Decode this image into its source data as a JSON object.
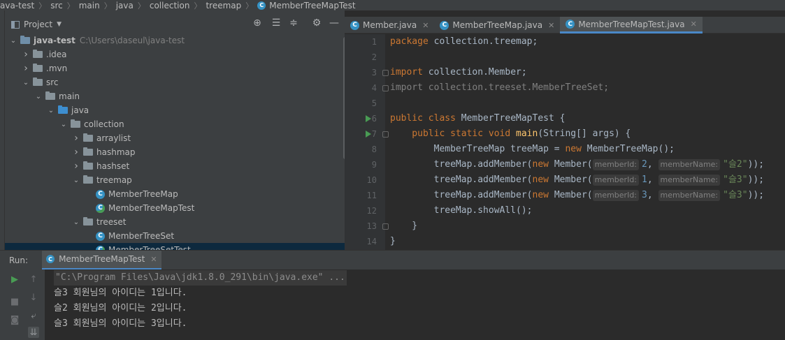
{
  "breadcrumb": [
    "ava-test",
    "src",
    "main",
    "java",
    "collection",
    "treemap",
    "MemberTreeMapTest"
  ],
  "project_panel": {
    "title": "Project",
    "tree": [
      {
        "label": "java-test",
        "extra": "C:\\Users\\daseul\\java-test",
        "icon": "module-folder-icon",
        "expanded": true,
        "depth": 0
      },
      {
        "label": ".idea",
        "icon": "folder-icon",
        "expanded": false,
        "depth": 1
      },
      {
        "label": ".mvn",
        "icon": "folder-icon",
        "expanded": false,
        "depth": 1
      },
      {
        "label": "src",
        "icon": "folder-icon",
        "expanded": true,
        "depth": 1
      },
      {
        "label": "main",
        "icon": "folder-icon",
        "expanded": true,
        "depth": 2
      },
      {
        "label": "java",
        "icon": "source-folder-icon",
        "expanded": true,
        "depth": 3
      },
      {
        "label": "collection",
        "icon": "package-icon",
        "expanded": true,
        "depth": 4
      },
      {
        "label": "arraylist",
        "icon": "package-icon",
        "expanded": false,
        "depth": 5
      },
      {
        "label": "hashmap",
        "icon": "package-icon",
        "expanded": false,
        "depth": 5
      },
      {
        "label": "hashset",
        "icon": "package-icon",
        "expanded": false,
        "depth": 5
      },
      {
        "label": "treemap",
        "icon": "package-icon",
        "expanded": true,
        "depth": 5
      },
      {
        "label": "MemberTreeMap",
        "icon": "class-icon",
        "depth": 6
      },
      {
        "label": "MemberTreeMapTest",
        "icon": "runnable-class-icon",
        "depth": 6
      },
      {
        "label": "treeset",
        "icon": "package-icon",
        "expanded": true,
        "depth": 5
      },
      {
        "label": "MemberTreeSet",
        "icon": "class-icon",
        "depth": 6
      },
      {
        "label": "MemberTreeSetTest",
        "icon": "runnable-class-icon",
        "depth": 6,
        "selected": true
      }
    ]
  },
  "editor": {
    "tabs": [
      {
        "label": "Member.java",
        "active": false
      },
      {
        "label": "MemberTreeMap.java",
        "active": false
      },
      {
        "label": "MemberTreeMapTest.java",
        "active": true
      }
    ],
    "code": {
      "l1_kw": "package ",
      "l1_rest": "collection.treemap;",
      "l3_kw": "import ",
      "l3_rest": "collection.Member;",
      "l4": "import collection.treeset.MemberTreeSet;",
      "l6_kw": "public class ",
      "l6_rest": "MemberTreeMapTest {",
      "l7_kw": "    public static void ",
      "l7_fn": "main",
      "l7_rest": "(String[] args) {",
      "l8_a": "        MemberTreeMap treeMap = ",
      "l8_kw": "new ",
      "l8_b": "MemberTreeMap();",
      "calls": [
        {
          "pre": "        treeMap.addMember(",
          "kw": "new ",
          "cls": "Member(",
          "hint1": "memberId:",
          "num": "2",
          "hint2": "memberName:",
          "str": "\"슬2\"",
          "end": "));"
        },
        {
          "pre": "        treeMap.addMember(",
          "kw": "new ",
          "cls": "Member(",
          "hint1": "memberId:",
          "num": "1",
          "hint2": "memberName:",
          "str": "\"슬3\"",
          "end": "));"
        },
        {
          "pre": "        treeMap.addMember(",
          "kw": "new ",
          "cls": "Member(",
          "hint1": "memberId:",
          "num": "3",
          "hint2": "memberName:",
          "str": "\"슬3\"",
          "end": "));"
        }
      ],
      "l12": "        treeMap.showAll();",
      "l13": "    }",
      "l14": "}",
      "line_numbers": [
        "1",
        "2",
        "3",
        "4",
        "5",
        "6",
        "7",
        "8",
        "9",
        "10",
        "11",
        "12",
        "13",
        "14"
      ]
    }
  },
  "run": {
    "label": "Run:",
    "tab": "MemberTreeMapTest",
    "output": [
      "\"C:\\Program Files\\Java\\jdk1.8.0_291\\bin\\java.exe\" ...",
      "슬3 회원님의 아이디는 1입니다.",
      "슬2 회원님의 아이디는 2입니다.",
      "슬3 회원님의 아이디는 3입니다."
    ]
  }
}
